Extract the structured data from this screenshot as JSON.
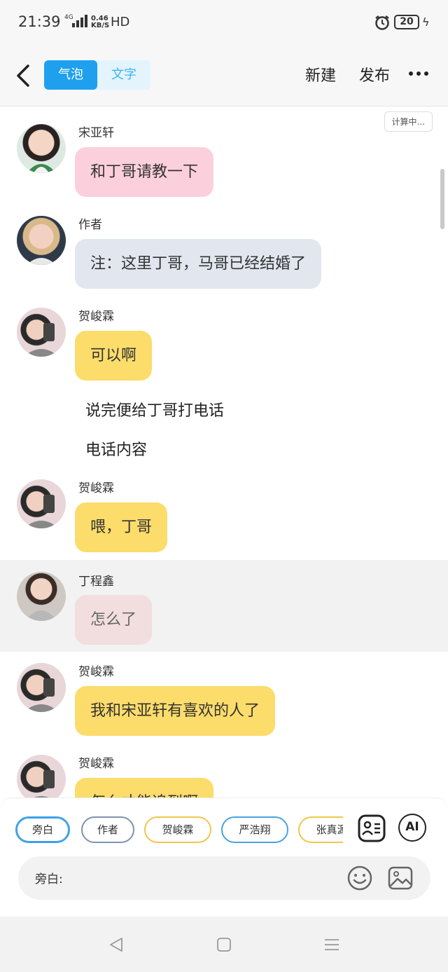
{
  "status_bar": {
    "time": "21:39",
    "network": "4G",
    "speed_value": "0.46",
    "speed_unit": "KB/S",
    "hd": "HD",
    "battery": "20"
  },
  "header": {
    "tabs": [
      {
        "label": "气泡",
        "active": true
      },
      {
        "label": "文字",
        "active": false
      }
    ],
    "new_label": "新建",
    "publish_label": "发布"
  },
  "timer_label": "计算中...",
  "messages": [
    {
      "type": "bubble",
      "name": "宋亚轩",
      "text": "和丁哥请教一下",
      "bubble_color": "#fccfdc",
      "avatar": "avatar-songyaxuan"
    },
    {
      "type": "bubble",
      "name": "作者",
      "text": "注：这里丁哥，马哥已经结婚了",
      "bubble_color": "#e1e6ef",
      "avatar": "avatar-author"
    },
    {
      "type": "bubble",
      "name": "贺峻霖",
      "text": "可以啊",
      "bubble_color": "#fcdc6a",
      "avatar": "avatar-hejunlin"
    },
    {
      "type": "narration",
      "text": "说完便给丁哥打电话"
    },
    {
      "type": "narration",
      "text": "电话内容"
    },
    {
      "type": "bubble",
      "name": "贺峻霖",
      "text": "喂，丁哥",
      "bubble_color": "#fcdc6a",
      "avatar": "avatar-hejunlin"
    },
    {
      "type": "bubble",
      "name": "丁程鑫",
      "text": "怎么了",
      "bubble_color": "#f2dede",
      "avatar": "avatar-dingchengxin",
      "highlighted": true
    },
    {
      "type": "bubble",
      "name": "贺峻霖",
      "text": "我和宋亚轩有喜欢的人了",
      "bubble_color": "#fcdc6a",
      "avatar": "avatar-hejunlin"
    },
    {
      "type": "bubble",
      "name": "贺峻霖",
      "text": "怎么才能追到啊",
      "bubble_color": "#fcdc6a",
      "avatar": "avatar-hejunlin"
    }
  ],
  "roles": [
    {
      "label": "旁白",
      "color": "#3aa0e8",
      "selected": true
    },
    {
      "label": "作者",
      "color": "#7f93ad"
    },
    {
      "label": "贺峻霖",
      "color": "#f0c64a"
    },
    {
      "label": "严浩翔",
      "color": "#4aa3de"
    },
    {
      "label": "张真源",
      "color": "#f0c64a"
    }
  ],
  "composer": {
    "prefix": "旁白:",
    "placeholder": "",
    "ai_label": "AI"
  },
  "icons": {
    "back": "back-arrow-icon",
    "more": "more-dots-icon",
    "role_card": "role-card-icon",
    "emoji": "emoji-icon",
    "image": "image-icon",
    "nav_back": "nav-back-icon",
    "nav_home": "nav-home-icon",
    "nav_menu": "nav-menu-icon"
  }
}
